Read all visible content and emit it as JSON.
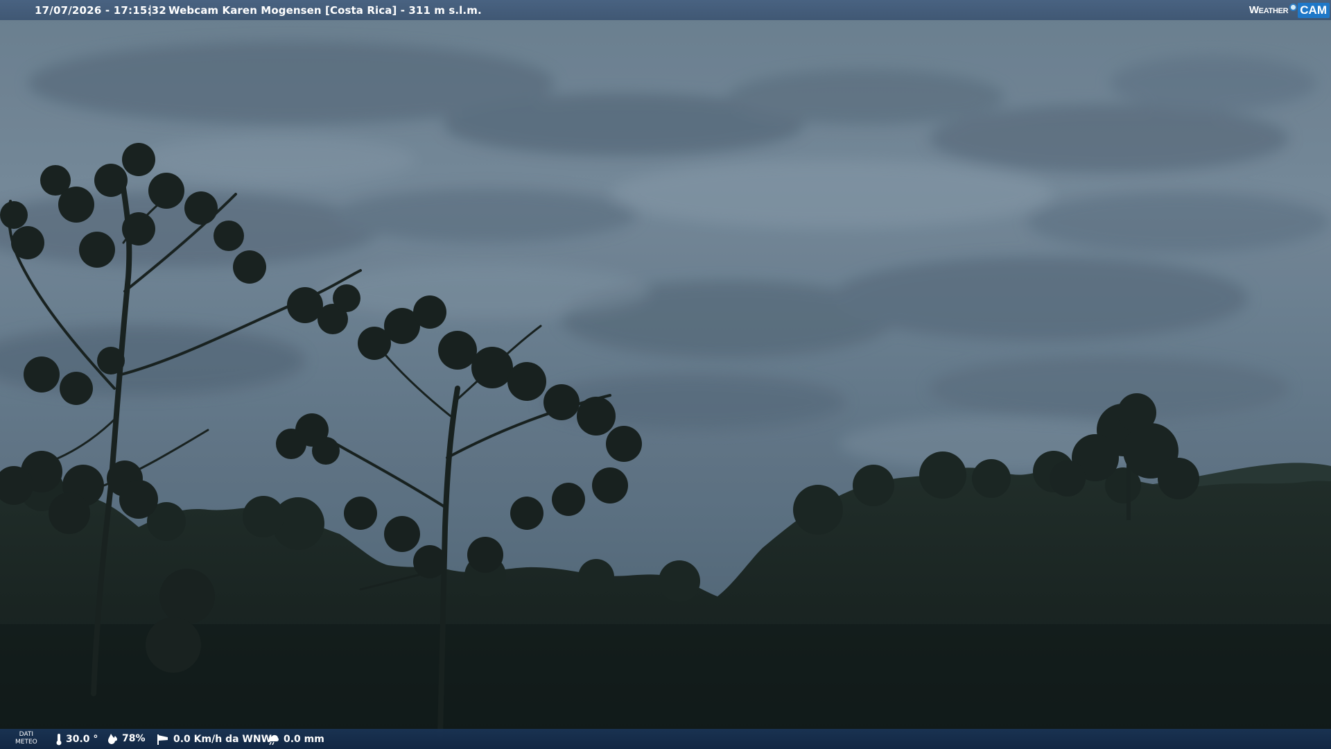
{
  "overlay": {
    "timestamp": "17/07/2026 - 17:15:32",
    "separator": "|",
    "title": "Webcam Karen Mogensen [Costa Rica]  - 311 m s.l.m."
  },
  "logo": {
    "weather": "Weather",
    "cam": "CAM"
  },
  "weather_data": {
    "label_line1": "DATI",
    "label_line2": "METEO",
    "temperature": "30.0 °",
    "humidity": "78%",
    "wind": "0.0 Km/h da WNW",
    "rain": "0.0 mm"
  },
  "icons": {
    "temperature": "thermometer-icon",
    "humidity": "humidity-drop-icon",
    "wind": "wind-sock-icon",
    "rain": "rain-cloud-icon"
  },
  "colors": {
    "sky": "#7b90a0",
    "foliage": "#1a2622",
    "top_bar": "#46608a",
    "bottom_bar": "#1a3456",
    "cam_badge": "#1f78c8"
  }
}
